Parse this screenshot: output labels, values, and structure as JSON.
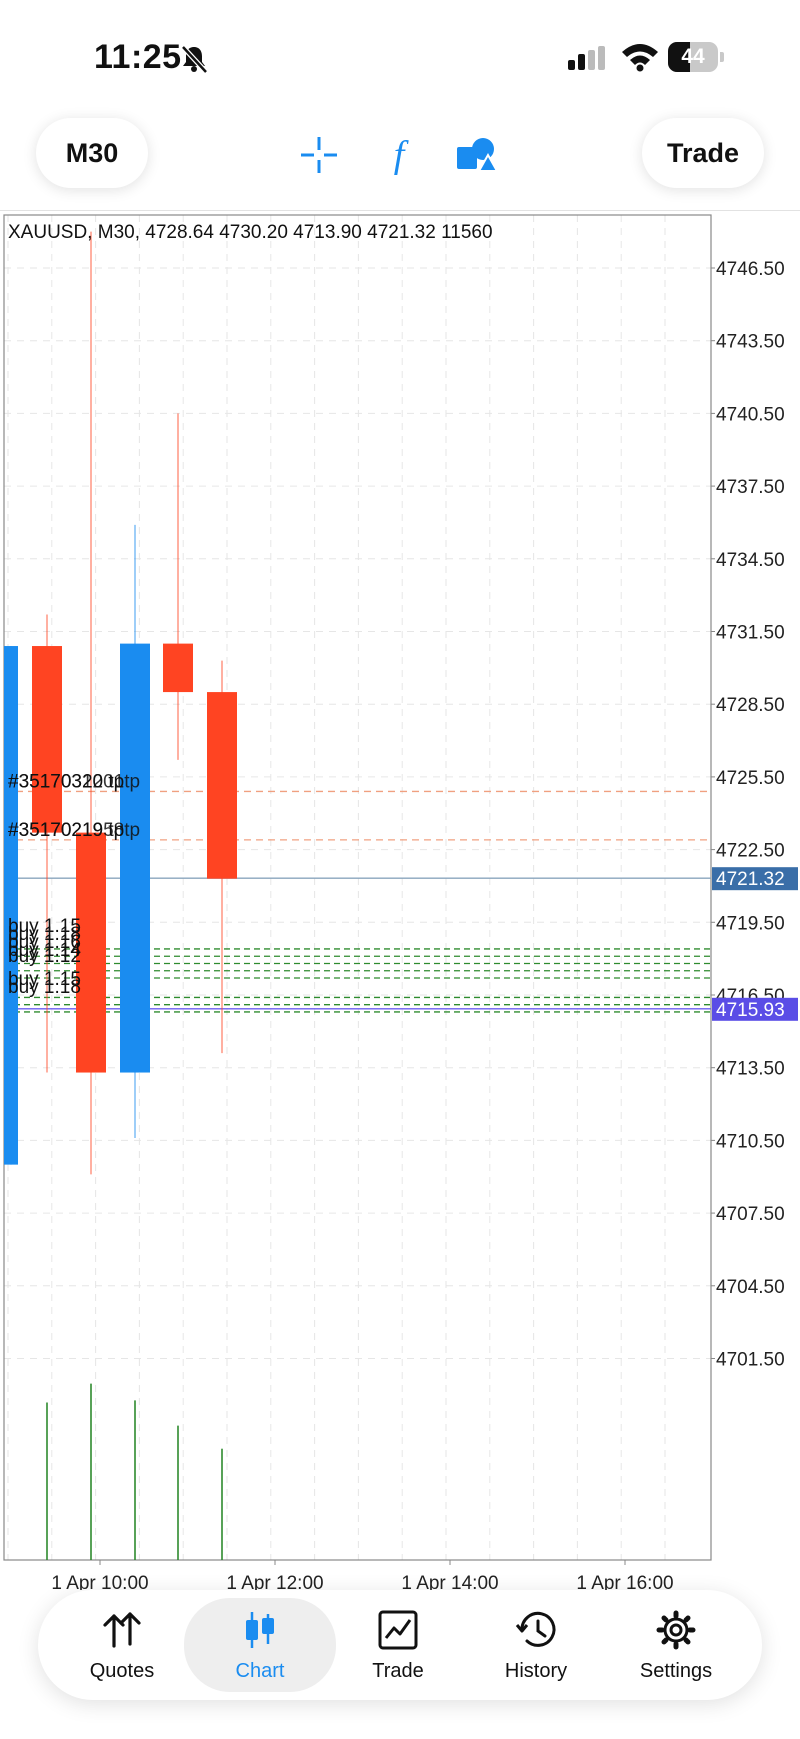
{
  "status_bar": {
    "time": "11:25",
    "battery": "44"
  },
  "toolbar": {
    "timeframe": "M30",
    "trade_label": "Trade",
    "icons": [
      "crosshair-icon",
      "indicator-f-icon",
      "shapes-icon"
    ]
  },
  "chart": {
    "header": "XAUUSD, M30, 4728.64 4730.20 4713.90 4721.32 11560",
    "price_ticks": [
      "4746.50",
      "4743.50",
      "4740.50",
      "4737.50",
      "4734.50",
      "4731.50",
      "4728.50",
      "4725.50",
      "4722.50",
      "4719.50",
      "4716.50",
      "4713.50",
      "4710.50",
      "4707.50",
      "4704.50",
      "4701.50"
    ],
    "time_ticks": [
      "1 Apr 10:00",
      "1 Apr 12:00",
      "1 Apr 14:00",
      "1 Apr 16:00"
    ],
    "current_price": "4721.32",
    "alt_price": "4715.93",
    "order_labels": [
      {
        "text": "#35170320 tp",
        "overlay": "#3517031201tp"
      },
      {
        "text": "#35170219 tp",
        "overlay": "#3517021958tp"
      }
    ],
    "buy_labels": [
      "buy 1.15",
      "buy 1.18",
      "buy 1.16",
      "buy 1.14",
      "buy 1.12",
      "buy 1.15",
      "buy 1.18"
    ],
    "colors": {
      "bull": "#1a8cf0",
      "bear": "#ff4422",
      "grid": "#e6e6e6",
      "current_price_bg": "#3a6ea8",
      "alt_price_bg": "#5a4de6",
      "tp_line": "#f0a080",
      "buy_line": "#2e8b2e"
    }
  },
  "chart_data": {
    "type": "candlestick",
    "title": "XAUUSD, M30, 4728.64 4730.20 4713.90 4721.32 11560",
    "ylim": [
      4698.5,
      4748.0
    ],
    "x": [
      "1 Apr 09:30",
      "1 Apr 10:00",
      "1 Apr 10:30",
      "1 Apr 11:00",
      "1 Apr 11:30",
      "1 Apr 12:00"
    ],
    "series": [
      {
        "open": 4709.5,
        "high": 4730.9,
        "low": 4709.5,
        "close": 4730.9
      },
      {
        "open": 4730.9,
        "high": 4732.2,
        "low": 4713.3,
        "close": 4723.2
      },
      {
        "open": 4723.2,
        "high": 4748.0,
        "low": 4709.1,
        "close": 4713.3
      },
      {
        "open": 4713.3,
        "high": 4735.9,
        "low": 4710.6,
        "close": 4731.0
      },
      {
        "open": 4731.0,
        "high": 4740.5,
        "low": 4726.2,
        "close": 4729.0
      },
      {
        "open": 4729.0,
        "high": 4730.3,
        "low": 4714.1,
        "close": 4721.3
      }
    ],
    "volume": [
      null,
      7500,
      8400,
      7600,
      6400,
      5300
    ],
    "levels": {
      "tp": [
        4724.9,
        4722.9
      ],
      "current": 4721.32,
      "alt": 4715.93,
      "buy": [
        4718.4,
        4718.1,
        4717.8,
        4717.5,
        4717.2,
        4716.4,
        4716.1,
        4715.8
      ]
    }
  },
  "nav": {
    "items": [
      {
        "label": "Quotes",
        "icon": "quotes-arrows-icon"
      },
      {
        "label": "Chart",
        "icon": "candles-icon"
      },
      {
        "label": "Trade",
        "icon": "trade-chart-icon"
      },
      {
        "label": "History",
        "icon": "history-clock-icon"
      },
      {
        "label": "Settings",
        "icon": "gear-icon"
      }
    ],
    "active": "Chart"
  }
}
